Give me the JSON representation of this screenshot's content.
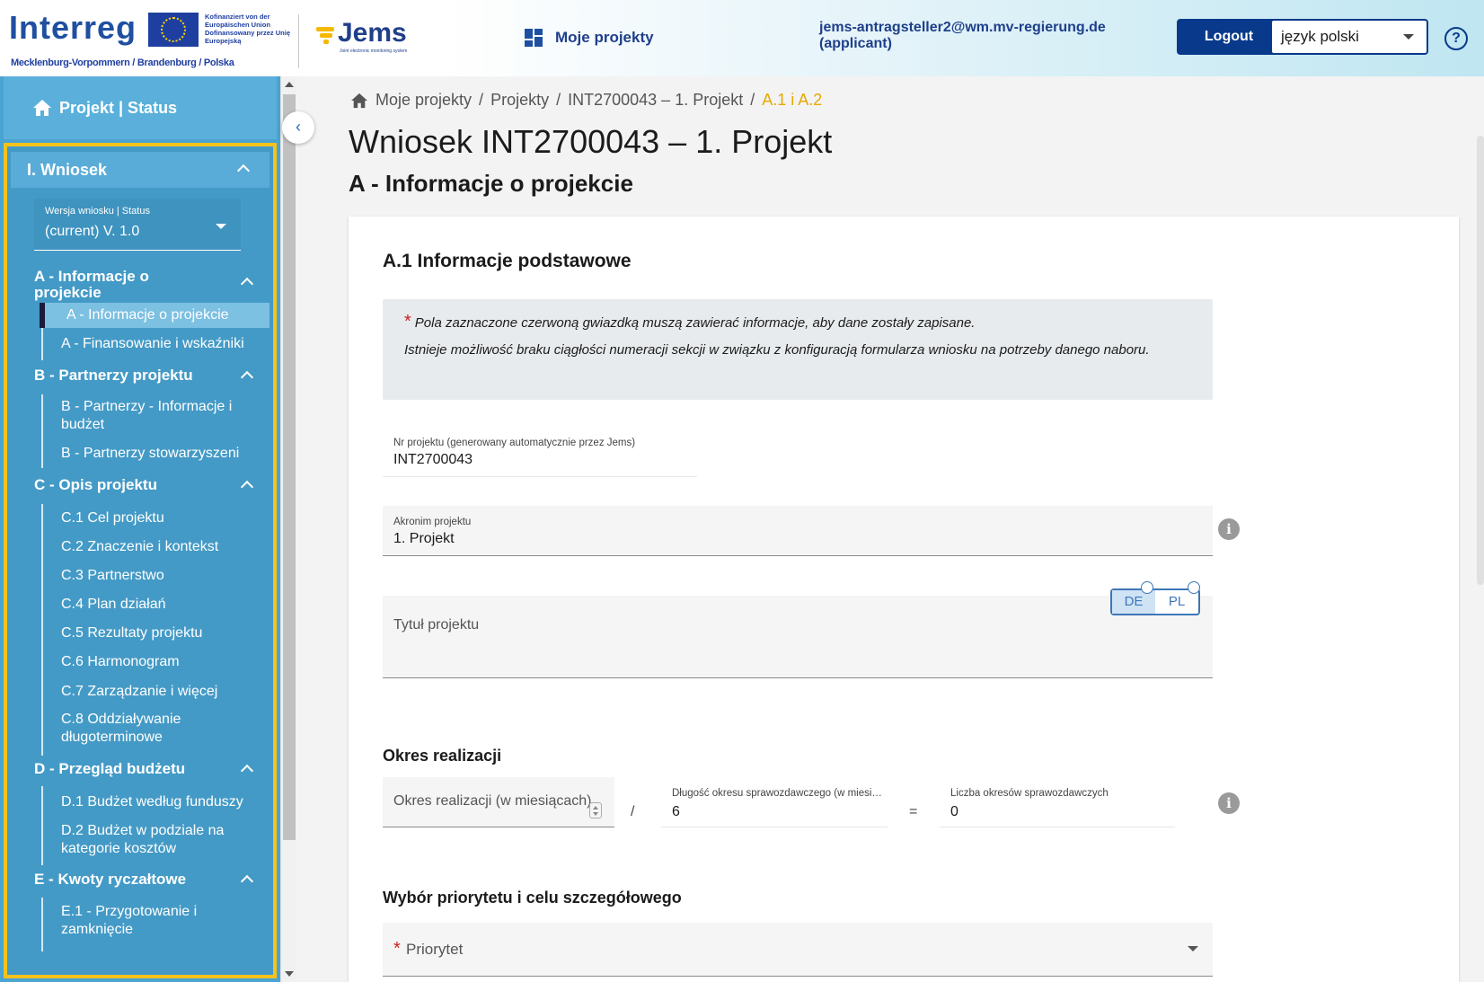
{
  "header": {
    "logo_word": "Interreg",
    "eu_text": "Kofinanziert von der Europäischen Union Dofinansowany przez Unię Europejską",
    "region": "Mecklenburg-Vorpommern / Brandenburg / Polska",
    "jems_logo": "Jems",
    "jems_sub": "Joint electronic monitoring system",
    "nav_projects": "Moje projekty",
    "user_email": "jems-antragsteller2@wm.mv-regierung.de",
    "user_role": "(applicant)",
    "logout": "Logout",
    "language": "język polski",
    "help": "?"
  },
  "sidebar": {
    "top_label": "Projekt | Status",
    "head_label": "I. Wniosek",
    "version_label": "Wersja wniosku | Status",
    "version_value": "(current) V. 1.0",
    "sections": [
      {
        "label": "A - Informacje o projekcie",
        "items": [
          "A - Informacje o projekcie",
          "A - Finansowanie i wskaźniki"
        ]
      },
      {
        "label": "B - Partnerzy projektu",
        "items": [
          "B - Partnerzy - Informacje i budżet",
          "B - Partnerzy stowarzyszeni"
        ]
      },
      {
        "label": "C - Opis projektu",
        "items": [
          "C.1 Cel projektu",
          "C.2 Znaczenie i kontekst",
          "C.3 Partnerstwo",
          "C.4 Plan działań",
          "C.5 Rezultaty projektu",
          "C.6 Harmonogram",
          "C.7 Zarządzanie i więcej",
          "C.8 Oddziaływanie długoterminowe"
        ]
      },
      {
        "label": "D - Przegląd budżetu",
        "items": [
          "D.1 Budżet według funduszy",
          "D.2 Budżet w podziale na kategorie kosztów"
        ]
      },
      {
        "label": "E - Kwoty ryczałtowe",
        "items": [
          "E.1 - Przygotowanie i zamknięcie"
        ]
      }
    ]
  },
  "breadcrumb": [
    "Moje projekty",
    "Projekty",
    "INT2700043 – 1. Projekt",
    "A.1 i A.2"
  ],
  "page": {
    "title": "Wniosek INT2700043 – 1. Projekt",
    "subtitle": "A - Informacje o projekcie"
  },
  "card": {
    "title": "A.1 Informacje podstawowe",
    "notice_line1": "Pola zaznaczone czerwoną gwiazdką muszą zawierać informacje, aby dane zostały zapisane.",
    "notice_line2": "Istnieje możliwość braku ciągłości numeracji sekcji w związku z konfiguracją formularza wniosku na potrzeby danego naboru.",
    "project_number_label": "Nr projektu (generowany automatycznie przez Jems)",
    "project_number_value": "INT2700043",
    "acronym_label": "Akronim projektu",
    "acronym_value": "1. Projekt",
    "lang_de": "DE",
    "lang_pl": "PL",
    "title_placeholder": "Tytuł projektu",
    "period_heading": "Okres realizacji",
    "period_placeholder": "Okres realizacji (w miesiącach)",
    "divide": "/",
    "reporting_length_label": "Długość okresu sprawozdawczego (w miesiącach)",
    "reporting_length_value": "6",
    "equals": "=",
    "reporting_count_label": "Liczba okresów sprawozdawczych",
    "reporting_count_value": "0",
    "priority_heading": "Wybór priorytetu i celu szczegółowego",
    "priority_placeholder": "Priorytet"
  },
  "colors": {
    "primary": "#08398b",
    "sidebar": "#4aa3d0",
    "highlight": "#f7c21b",
    "breadcrumb_current": "#e5a900",
    "required": "#d12020"
  }
}
